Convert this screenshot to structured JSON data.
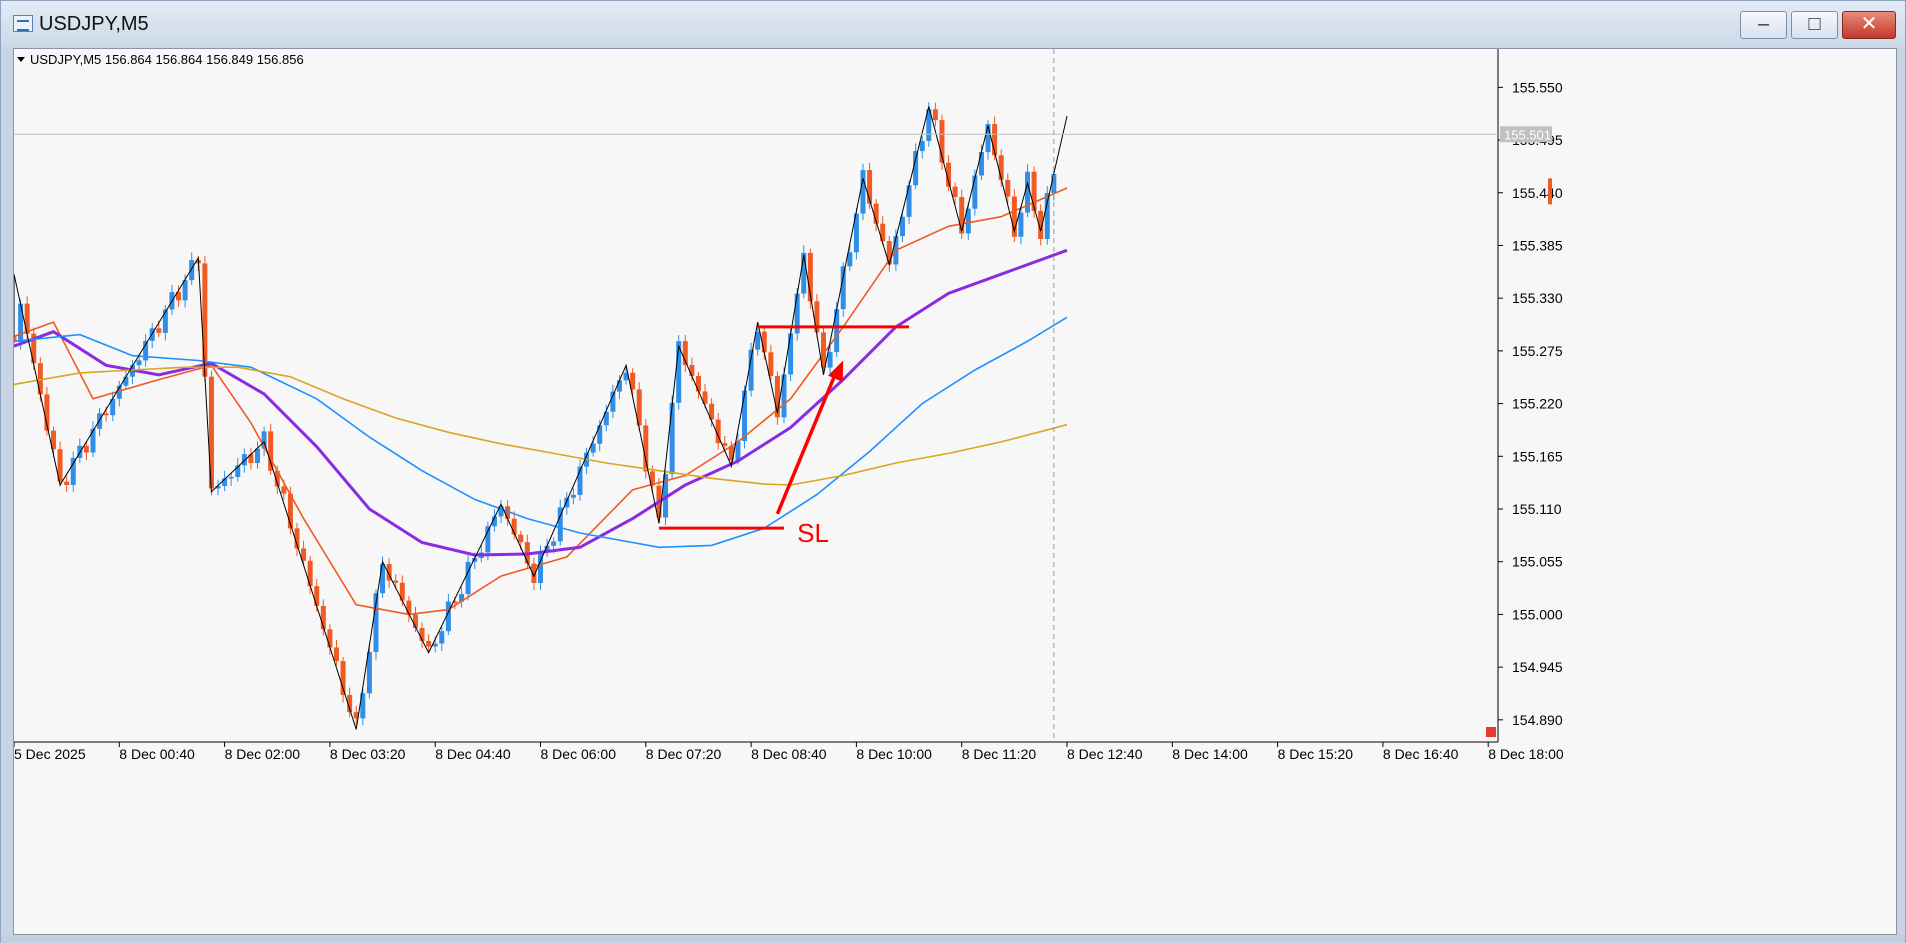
{
  "window": {
    "title": "USDJPY,M5",
    "min_glyph": "–",
    "max_glyph": "□",
    "close_glyph": "✕"
  },
  "info_line": "USDJPY,M5  156.864 156.864 156.849 156.856",
  "price_labels": [
    "155.550",
    "155.495",
    "155.440",
    "155.385",
    "155.330",
    "155.275",
    "155.220",
    "155.165",
    "155.110",
    "155.055",
    "155.000",
    "154.945",
    "154.890"
  ],
  "current_price_label": "155.501",
  "time_labels": [
    "5 Dec 2025",
    "8 Dec 00:40",
    "8 Dec 02:00",
    "8 Dec 03:20",
    "8 Dec 04:40",
    "8 Dec 06:00",
    "8 Dec 07:20",
    "8 Dec 08:40",
    "8 Dec 10:00",
    "8 Dec 11:20",
    "8 Dec 12:40",
    "8 Dec 14:00",
    "8 Dec 15:20",
    "8 Dec 16:40",
    "8 Dec 18:00"
  ],
  "annotation": {
    "text": "SL",
    "color": "#ff0000"
  },
  "colors": {
    "bull": "#2f8fe8",
    "bear": "#f05a23",
    "ma_fast": "#f05a23",
    "ma_purple": "#8a2be2",
    "ma_blue": "#1e90ff",
    "ma_gold": "#daa520",
    "zigzag": "#000000"
  },
  "chart_data": {
    "type": "candlestick",
    "symbol": "USDJPY",
    "timeframe": "M5",
    "y_range": [
      154.87,
      155.59
    ],
    "current_price": 155.501,
    "x_time_range": [
      "5 Dec 23:30",
      "8 Dec 18:00"
    ],
    "candles_start": "5 Dec 23:30",
    "last_candle": "8 Dec 12:40",
    "zigzag_pivots": [
      {
        "t": "5 Dec 23:30",
        "p": 155.29
      },
      {
        "t": "5 Dec 23:55",
        "p": 155.355
      },
      {
        "t": "8 Dec 00:05",
        "p": 155.135
      },
      {
        "t": "8 Dec 01:50",
        "p": 155.372
      },
      {
        "t": "8 Dec 02:00",
        "p": 155.128
      },
      {
        "t": "8 Dec 02:40",
        "p": 155.18
      },
      {
        "t": "8 Dec 03:50",
        "p": 154.88
      },
      {
        "t": "8 Dec 04:10",
        "p": 155.055
      },
      {
        "t": "8 Dec 04:45",
        "p": 154.96
      },
      {
        "t": "8 Dec 05:40",
        "p": 155.115
      },
      {
        "t": "8 Dec 06:05",
        "p": 155.04
      },
      {
        "t": "8 Dec 07:15",
        "p": 155.26
      },
      {
        "t": "8 Dec 07:40",
        "p": 155.095
      },
      {
        "t": "8 Dec 07:55",
        "p": 155.28
      },
      {
        "t": "8 Dec 08:35",
        "p": 155.155
      },
      {
        "t": "8 Dec 08:55",
        "p": 155.305
      },
      {
        "t": "8 Dec 09:10",
        "p": 155.21
      },
      {
        "t": "8 Dec 09:30",
        "p": 155.375
      },
      {
        "t": "8 Dec 09:45",
        "p": 155.25
      },
      {
        "t": "8 Dec 10:15",
        "p": 155.455
      },
      {
        "t": "8 Dec 10:35",
        "p": 155.365
      },
      {
        "t": "8 Dec 11:05",
        "p": 155.53
      },
      {
        "t": "8 Dec 11:30",
        "p": 155.4
      },
      {
        "t": "8 Dec 11:50",
        "p": 155.51
      },
      {
        "t": "8 Dec 12:10",
        "p": 155.4
      },
      {
        "t": "8 Dec 12:20",
        "p": 155.45
      },
      {
        "t": "8 Dec 12:30",
        "p": 155.4
      },
      {
        "t": "8 Dec 12:50",
        "p": 155.52
      }
    ],
    "moving_averages": [
      {
        "color": "#f05a23",
        "points": [
          {
            "t": "5 Dec 23:30",
            "p": 155.29
          },
          {
            "t": "8 Dec 00:00",
            "p": 155.305
          },
          {
            "t": "8 Dec 00:30",
            "p": 155.225
          },
          {
            "t": "8 Dec 01:20",
            "p": 155.245
          },
          {
            "t": "8 Dec 02:00",
            "p": 155.26
          },
          {
            "t": "8 Dec 02:30",
            "p": 155.2
          },
          {
            "t": "8 Dec 03:10",
            "p": 155.1
          },
          {
            "t": "8 Dec 03:50",
            "p": 155.01
          },
          {
            "t": "8 Dec 04:30",
            "p": 155.0
          },
          {
            "t": "8 Dec 05:00",
            "p": 155.005
          },
          {
            "t": "8 Dec 05:40",
            "p": 155.04
          },
          {
            "t": "8 Dec 06:30",
            "p": 155.06
          },
          {
            "t": "8 Dec 07:20",
            "p": 155.13
          },
          {
            "t": "8 Dec 08:00",
            "p": 155.145
          },
          {
            "t": "8 Dec 08:40",
            "p": 155.18
          },
          {
            "t": "8 Dec 09:20",
            "p": 155.225
          },
          {
            "t": "8 Dec 10:00",
            "p": 155.3
          },
          {
            "t": "8 Dec 10:40",
            "p": 155.38
          },
          {
            "t": "8 Dec 11:20",
            "p": 155.405
          },
          {
            "t": "8 Dec 12:00",
            "p": 155.415
          },
          {
            "t": "8 Dec 12:50",
            "p": 155.445
          }
        ]
      },
      {
        "color": "#8a2be2",
        "points": [
          {
            "t": "5 Dec 23:30",
            "p": 155.28
          },
          {
            "t": "8 Dec 00:00",
            "p": 155.295
          },
          {
            "t": "8 Dec 00:40",
            "p": 155.26
          },
          {
            "t": "8 Dec 01:20",
            "p": 155.25
          },
          {
            "t": "8 Dec 02:00",
            "p": 155.262
          },
          {
            "t": "8 Dec 02:40",
            "p": 155.23
          },
          {
            "t": "8 Dec 03:20",
            "p": 155.175
          },
          {
            "t": "8 Dec 04:00",
            "p": 155.11
          },
          {
            "t": "8 Dec 04:40",
            "p": 155.075
          },
          {
            "t": "8 Dec 05:20",
            "p": 155.062
          },
          {
            "t": "8 Dec 06:00",
            "p": 155.063
          },
          {
            "t": "8 Dec 06:40",
            "p": 155.07
          },
          {
            "t": "8 Dec 07:20",
            "p": 155.1
          },
          {
            "t": "8 Dec 08:00",
            "p": 155.135
          },
          {
            "t": "8 Dec 08:40",
            "p": 155.16
          },
          {
            "t": "8 Dec 09:20",
            "p": 155.195
          },
          {
            "t": "8 Dec 10:00",
            "p": 155.245
          },
          {
            "t": "8 Dec 10:40",
            "p": 155.3
          },
          {
            "t": "8 Dec 11:20",
            "p": 155.335
          },
          {
            "t": "8 Dec 12:00",
            "p": 155.355
          },
          {
            "t": "8 Dec 12:50",
            "p": 155.38
          }
        ]
      },
      {
        "color": "#1e90ff",
        "points": [
          {
            "t": "5 Dec 23:30",
            "p": 155.285
          },
          {
            "t": "8 Dec 00:20",
            "p": 155.292
          },
          {
            "t": "8 Dec 01:00",
            "p": 155.27
          },
          {
            "t": "8 Dec 01:50",
            "p": 155.265
          },
          {
            "t": "8 Dec 02:30",
            "p": 155.258
          },
          {
            "t": "8 Dec 03:20",
            "p": 155.225
          },
          {
            "t": "8 Dec 04:00",
            "p": 155.185
          },
          {
            "t": "8 Dec 04:40",
            "p": 155.15
          },
          {
            "t": "8 Dec 05:20",
            "p": 155.12
          },
          {
            "t": "8 Dec 06:00",
            "p": 155.1
          },
          {
            "t": "8 Dec 06:40",
            "p": 155.085
          },
          {
            "t": "8 Dec 07:20",
            "p": 155.075
          },
          {
            "t": "8 Dec 07:40",
            "p": 155.07
          },
          {
            "t": "8 Dec 08:20",
            "p": 155.072
          },
          {
            "t": "8 Dec 09:00",
            "p": 155.09
          },
          {
            "t": "8 Dec 09:40",
            "p": 155.125
          },
          {
            "t": "8 Dec 10:20",
            "p": 155.17
          },
          {
            "t": "8 Dec 11:00",
            "p": 155.22
          },
          {
            "t": "8 Dec 11:40",
            "p": 155.255
          },
          {
            "t": "8 Dec 12:20",
            "p": 155.285
          },
          {
            "t": "8 Dec 12:50",
            "p": 155.31
          }
        ]
      },
      {
        "color": "#daa520",
        "points": [
          {
            "t": "5 Dec 23:30",
            "p": 155.24
          },
          {
            "t": "8 Dec 00:20",
            "p": 155.252
          },
          {
            "t": "8 Dec 01:00",
            "p": 155.255
          },
          {
            "t": "8 Dec 01:40",
            "p": 155.258
          },
          {
            "t": "8 Dec 02:20",
            "p": 155.258
          },
          {
            "t": "8 Dec 03:00",
            "p": 155.248
          },
          {
            "t": "8 Dec 03:40",
            "p": 155.225
          },
          {
            "t": "8 Dec 04:20",
            "p": 155.205
          },
          {
            "t": "8 Dec 05:00",
            "p": 155.19
          },
          {
            "t": "8 Dec 05:40",
            "p": 155.178
          },
          {
            "t": "8 Dec 06:20",
            "p": 155.168
          },
          {
            "t": "8 Dec 07:00",
            "p": 155.158
          },
          {
            "t": "8 Dec 07:40",
            "p": 155.15
          },
          {
            "t": "8 Dec 08:20",
            "p": 155.142
          },
          {
            "t": "8 Dec 09:00",
            "p": 155.136
          },
          {
            "t": "8 Dec 09:20",
            "p": 155.135
          },
          {
            "t": "8 Dec 10:00",
            "p": 155.145
          },
          {
            "t": "8 Dec 10:40",
            "p": 155.158
          },
          {
            "t": "8 Dec 11:20",
            "p": 155.168
          },
          {
            "t": "8 Dec 12:00",
            "p": 155.18
          },
          {
            "t": "8 Dec 12:50",
            "p": 155.198
          }
        ]
      }
    ],
    "horizontal_lines": [
      {
        "color": "#ff0000",
        "price": 155.3,
        "from": "8 Dec 08:55",
        "to": "8 Dec 10:50"
      },
      {
        "color": "#ff0000",
        "price": 155.09,
        "from": "8 Dec 07:40",
        "to": "8 Dec 09:15"
      }
    ],
    "arrow": {
      "color": "#ff0000",
      "from": {
        "t": "8 Dec 09:10",
        "p": 155.105
      },
      "to": {
        "t": "8 Dec 10:00",
        "p": 155.265
      }
    },
    "sl_label": {
      "text": "SL",
      "t": "8 Dec 09:25",
      "p": 155.085
    }
  }
}
